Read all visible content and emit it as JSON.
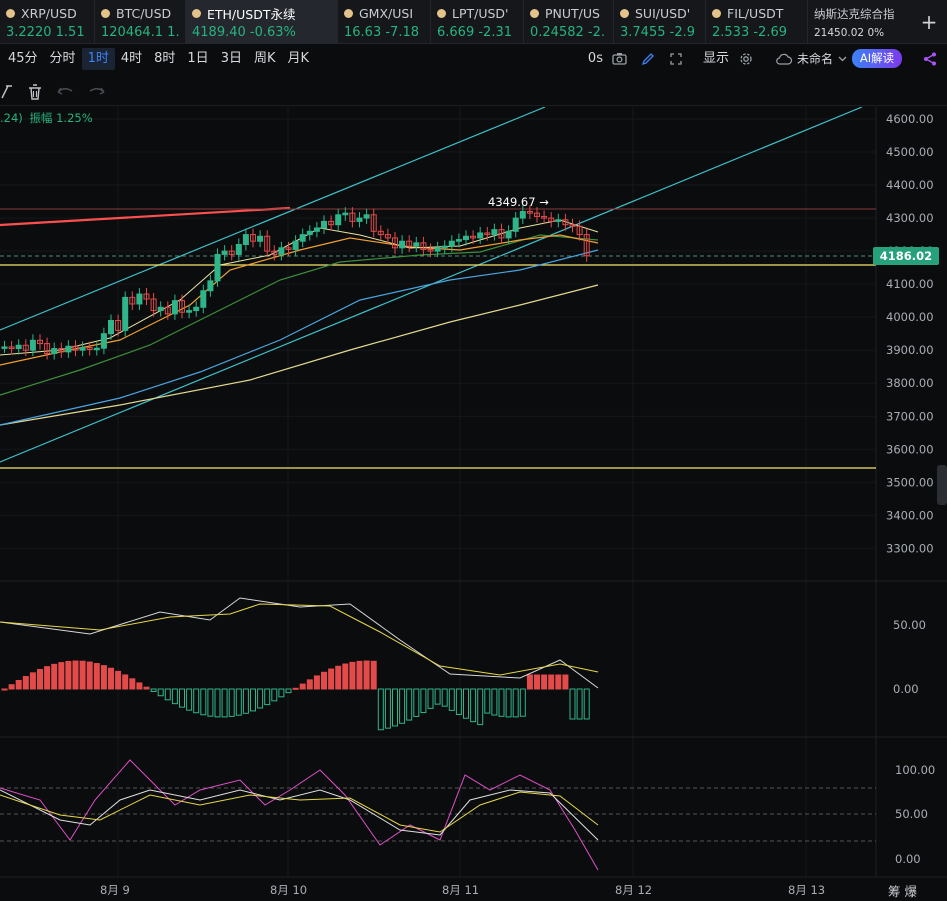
{
  "tickers": [
    {
      "symbol": "XRP/USD",
      "price": "3.2220",
      "change": "1.51",
      "color": "#27b37e",
      "active": false
    },
    {
      "symbol": "BTC/USD",
      "price": "120464.1",
      "change": "1.",
      "color": "#27b37e",
      "active": false
    },
    {
      "symbol": "ETH/USDT永续",
      "price": "4189.40",
      "change": "-0.63%",
      "color": "#27b37e",
      "active": true
    },
    {
      "symbol": "GMX/USI",
      "price": "16.63",
      "change": "-7.18",
      "color": "#27b37e",
      "active": false
    },
    {
      "symbol": "LPT/USD'",
      "price": "6.669",
      "change": "-2.31",
      "color": "#27b37e",
      "active": false
    },
    {
      "symbol": "PNUT/US",
      "price": "0.24582",
      "change": "-2.",
      "color": "#27b37e",
      "active": false
    },
    {
      "symbol": "SUI/USD'",
      "price": "3.7455",
      "change": "-2.9",
      "color": "#27b37e",
      "active": false
    },
    {
      "symbol": "FIL/USDT",
      "price": "2.533",
      "change": "-2.69",
      "color": "#27b37e",
      "active": false
    }
  ],
  "index_ticker": {
    "name": "纳斯达克综合指",
    "value": "21450.02",
    "change": "0%"
  },
  "add_tab": "+",
  "timeframes": [
    "45分",
    "分时",
    "1时",
    "4时",
    "8时",
    "1日",
    "3日",
    "周K",
    "月K"
  ],
  "active_timeframe": "1时",
  "toolbar": {
    "seconds": "0s",
    "display": "显示",
    "layout_name": "未命名",
    "ai_label": "AI解读"
  },
  "overlay": {
    "amplitude_prefix": ".24)",
    "amplitude": "振幅 1.25%"
  },
  "price_axis": {
    "ticks": [
      "4600.00",
      "4500.00",
      "4400.00",
      "4300.00",
      "4200.00",
      "4100.00",
      "4000.00",
      "3900.00",
      "3800.00",
      "3700.00",
      "3600.00",
      "3500.00",
      "3400.00",
      "3300.00"
    ],
    "current": "4186.02"
  },
  "macd_axis": {
    "ticks": [
      "50.00",
      "0.00"
    ]
  },
  "kdj_axis": {
    "ticks": [
      "100.00",
      "50.00",
      "0.00"
    ]
  },
  "time_axis": {
    "labels": [
      "8月 9",
      "8月 10",
      "8月 11",
      "8月 12",
      "8月 13"
    ]
  },
  "high_label": "4349.67 →",
  "bottom_right": "筹  爆",
  "colors": {
    "up": "#2fb58a",
    "down": "#e34b4b",
    "ma_short": "#e8e4a0",
    "ma_mid": "#f0a030",
    "ma_long": "#3c8f3c",
    "ma_blue": "#4aa5e0",
    "ma_yellow": "#e0d890",
    "channel": "#3fc0c8",
    "hline": "#f5e46a",
    "red_line": "#ff5050"
  },
  "chart_data": {
    "type": "candlestick",
    "interval": "1h",
    "candles": [
      3910,
      3905,
      3915,
      3900,
      3930,
      3920,
      3890,
      3905,
      3895,
      3912,
      3900,
      3908,
      3902,
      3906,
      3950,
      3990,
      3960,
      4060,
      4040,
      4070,
      4055,
      4020,
      4030,
      4010,
      4050,
      4015,
      4020,
      4030,
      4080,
      4110,
      4190,
      4200,
      4190,
      4220,
      4250,
      4230,
      4245,
      4200,
      4190,
      4210,
      4205,
      4230,
      4250,
      4260,
      4270,
      4290,
      4280,
      4310,
      4315,
      4290,
      4300,
      4310,
      4260,
      4250,
      4240,
      4210,
      4230,
      4215,
      4225,
      4205,
      4200,
      4210,
      4215,
      4230,
      4235,
      4245,
      4240,
      4255,
      4250,
      4265,
      4240,
      4260,
      4300,
      4320,
      4315,
      4305,
      4300,
      4290,
      4295,
      4280,
      4275,
      4250,
      4186
    ],
    "channel_upper": [
      [
        0,
        330
      ],
      [
        545,
        107
      ]
    ],
    "channel_lower": [
      [
        0,
        462
      ],
      [
        862,
        107
      ]
    ],
    "red_trendline": {
      "from": 4290,
      "to": 4330
    },
    "horizontal_levels": [
      4160,
      3540,
      4330
    ],
    "current_price": 4186.02,
    "high": 4349.67
  }
}
